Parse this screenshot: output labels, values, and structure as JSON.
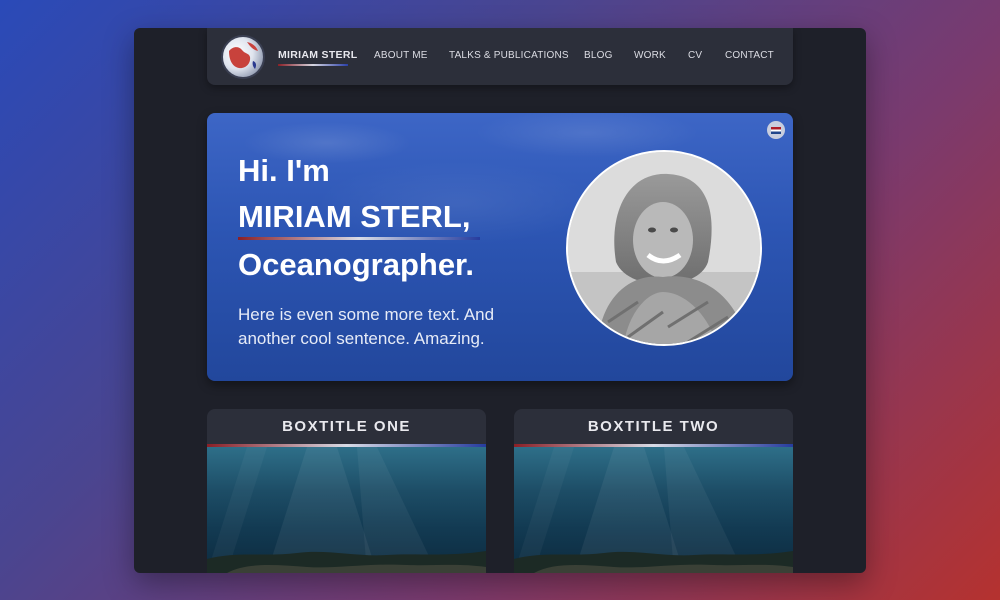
{
  "nav": {
    "brand": "MIRIAM STERL",
    "logo": "globe-logo-icon",
    "links": [
      {
        "label": "ABOUT ME"
      },
      {
        "label": "TALKS & PUBLICATIONS"
      },
      {
        "label": "BLOG"
      },
      {
        "label": "WORK"
      },
      {
        "label": "CV"
      },
      {
        "label": "CONTACT"
      }
    ]
  },
  "hero": {
    "greeting": "Hi. I'm",
    "name": "MIRIAM STERL,",
    "role": "Oceanographer.",
    "description": "Here is even some more text. And another cool sentence. Amazing.",
    "language_flag": "dutch-flag-icon"
  },
  "boxes": [
    {
      "title": "BOXTITLE ONE",
      "image": "underwater-scene"
    },
    {
      "title": "BOXTITLE TWO",
      "image": "underwater-scene"
    }
  ],
  "colors": {
    "accent_red": "#8a1f26",
    "accent_blue": "#263c9e",
    "window_bg": "#1e2029",
    "nav_bg": "#2c2f3a",
    "hero_blue": "#2c55b3"
  }
}
